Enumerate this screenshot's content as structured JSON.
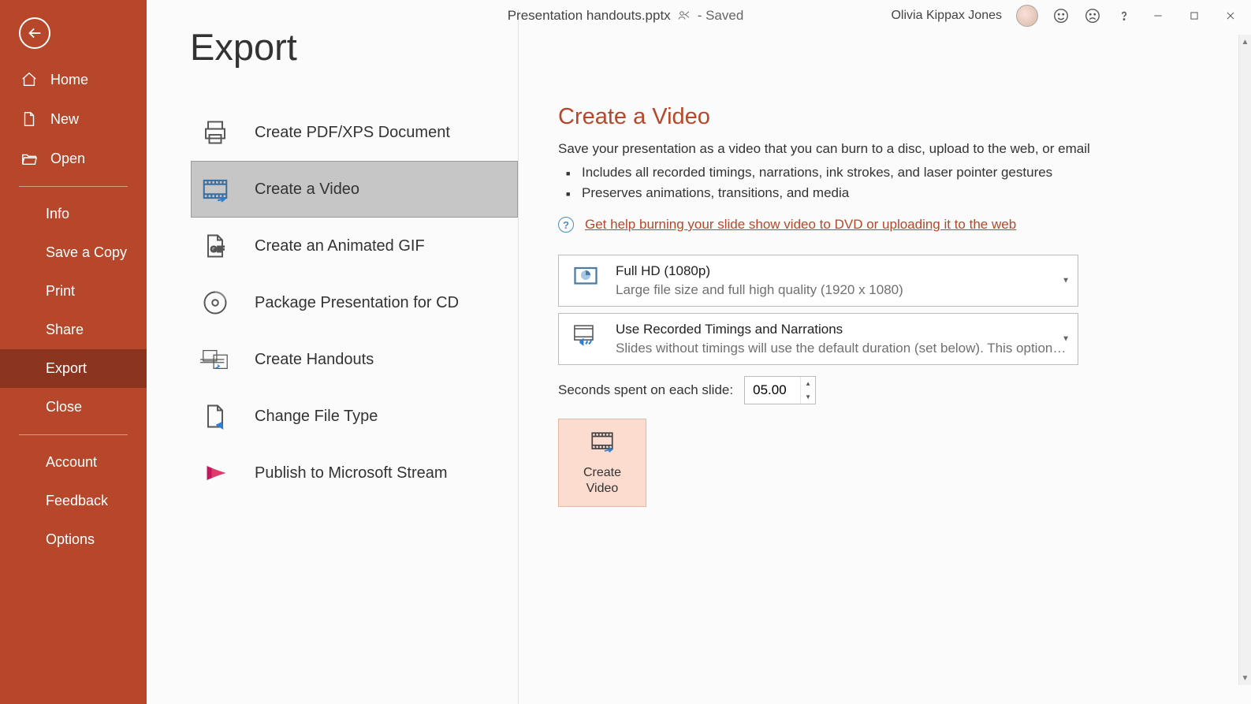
{
  "titlebar": {
    "filename": "Presentation handouts.pptx",
    "status": "- Saved",
    "user": "Olivia Kippax Jones"
  },
  "page": {
    "heading": "Export"
  },
  "sidebar": {
    "home": "Home",
    "new": "New",
    "open": "Open",
    "info": "Info",
    "save_copy": "Save a Copy",
    "print": "Print",
    "share": "Share",
    "export": "Export",
    "close": "Close",
    "account": "Account",
    "feedback": "Feedback",
    "options": "Options"
  },
  "export_options": {
    "pdf": "Create PDF/XPS Document",
    "video": "Create a Video",
    "gif": "Create an Animated GIF",
    "cd": "Package Presentation for CD",
    "handouts": "Create Handouts",
    "filetype": "Change File Type",
    "stream": "Publish to Microsoft Stream"
  },
  "detail": {
    "title": "Create a Video",
    "desc": "Save your presentation as a video that you can burn to a disc, upload to the web, or email",
    "bullet1": "Includes all recorded timings, narrations, ink strokes, and laser pointer gestures",
    "bullet2": "Preserves animations, transitions, and media",
    "help_link": "Get help burning your slide show video to DVD or uploading it to the web",
    "quality": {
      "title": "Full HD (1080p)",
      "sub": "Large file size and full high quality (1920 x 1080)"
    },
    "timings": {
      "title": "Use Recorded Timings and Narrations",
      "sub": "Slides without timings will use the default duration (set below). This option incl…"
    },
    "seconds_label": "Seconds spent on each slide:",
    "seconds_value": "05.00",
    "create_label": "Create\nVideo"
  }
}
